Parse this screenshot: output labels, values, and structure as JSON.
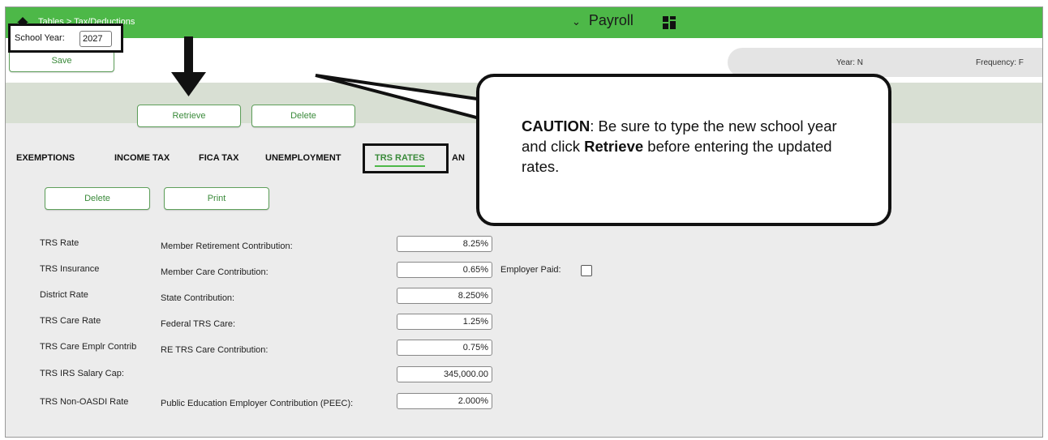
{
  "header": {
    "breadcrumb": "Tables > Tax/Deductions",
    "module_name": "Payroll",
    "accent_color": "#4db848"
  },
  "toolbar": {
    "save_label": "Save"
  },
  "info_bar": {
    "year": "Year: N",
    "frequency": "Frequency: F"
  },
  "school_year": {
    "label": "School Year:",
    "value": "2027",
    "retrieve_label": "Retrieve",
    "delete_label": "Delete"
  },
  "tabs": [
    {
      "label": "EXEMPTIONS"
    },
    {
      "label": "INCOME TAX"
    },
    {
      "label": "FICA TAX"
    },
    {
      "label": "UNEMPLOYMENT"
    },
    {
      "label": "TRS RATES"
    },
    {
      "label": "AN"
    }
  ],
  "tab_actions": {
    "delete_label": "Delete",
    "print_label": "Print"
  },
  "rates": [
    {
      "label": "TRS Rate",
      "description": "Member Retirement Contribution:",
      "value": "8.25%"
    },
    {
      "label": "TRS Insurance",
      "description": "Member Care Contribution:",
      "value": "0.65%"
    },
    {
      "label": "District Rate",
      "description": "State Contribution:",
      "value": "8.250%"
    },
    {
      "label": "TRS Care Rate",
      "description": "Federal TRS Care:",
      "value": "1.25%"
    },
    {
      "label": "TRS Care Emplr Contrib",
      "description": "RE TRS Care Contribution:",
      "value": "0.75%"
    },
    {
      "label": "TRS IRS Salary Cap:",
      "description": "",
      "value": "345,000.00"
    },
    {
      "label": "TRS Non-OASDI Rate",
      "description": "Public Education Employer Contribution (PEEC):",
      "value": "2.000%"
    }
  ],
  "employer_paid_label": "Employer Paid:",
  "callout": {
    "caution_word": "CAUTION",
    "text_1": ": Be sure to type the new school year and click ",
    "bold_word": "Retrieve",
    "text_2": " before entering the updated rates."
  }
}
